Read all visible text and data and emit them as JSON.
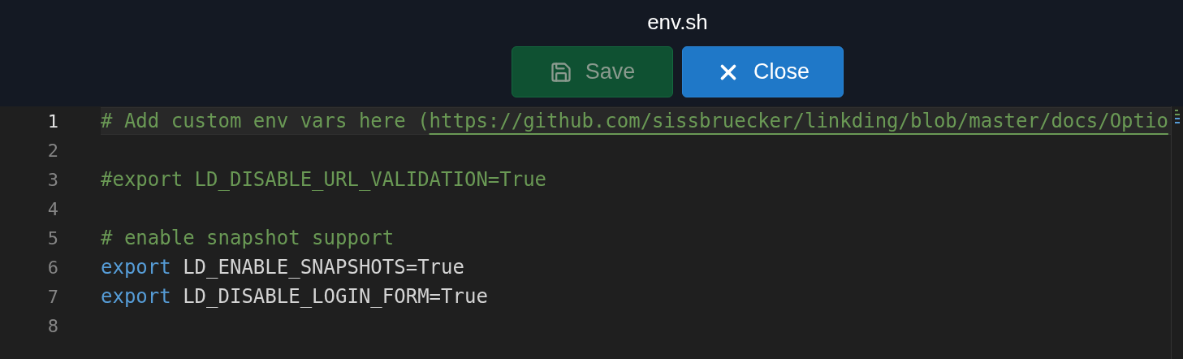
{
  "title": "env.sh",
  "buttons": [
    {
      "kind": "save",
      "label": "Save",
      "disabled": true
    },
    {
      "kind": "close",
      "label": "Close",
      "disabled": false
    }
  ],
  "editor": {
    "lines": [
      {
        "number": "1",
        "current": true,
        "tokens": [
          {
            "kind": "comment",
            "text": "# Add custom env vars here ("
          },
          {
            "kind": "link",
            "text": "https://github.com/sissbruecker/linkding/blob/master/docs/Optio"
          }
        ]
      },
      {
        "number": "2",
        "current": false
      },
      {
        "number": "3",
        "current": false,
        "tokens": [
          {
            "kind": "comment",
            "text": "#export LD_DISABLE_URL_VALIDATION=True"
          }
        ]
      },
      {
        "number": "4",
        "current": false
      },
      {
        "number": "5",
        "current": false,
        "tokens": [
          {
            "kind": "comment",
            "text": "# enable snapshot support"
          }
        ]
      },
      {
        "number": "6",
        "current": false,
        "tokens": [
          {
            "kind": "keyword",
            "text": "export"
          },
          {
            "kind": "plain",
            "text": " LD_ENABLE_SNAPSHOTS=True"
          }
        ]
      },
      {
        "number": "7",
        "current": false,
        "tokens": [
          {
            "kind": "keyword",
            "text": "export"
          },
          {
            "kind": "plain",
            "text": " LD_DISABLE_LOGIN_FORM=True"
          }
        ]
      },
      {
        "number": "8",
        "current": false
      }
    ]
  }
}
